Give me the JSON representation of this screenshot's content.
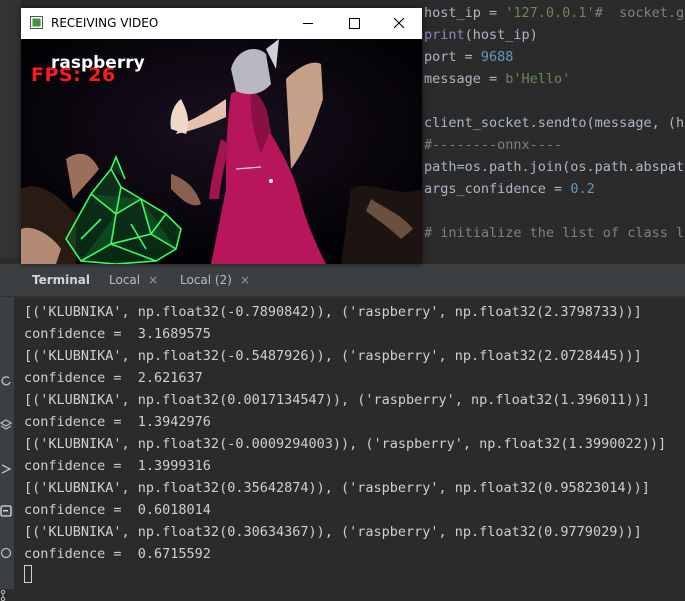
{
  "editor": {
    "lines": [
      {
        "name": "code-host-ip",
        "parts": [
          {
            "t": "host_ip = ",
            "c": "c-name"
          },
          {
            "t": "'127.0.0.1'",
            "c": "c-str"
          },
          {
            "t": "#  socket.ge",
            "c": "c-com"
          }
        ]
      },
      {
        "name": "code-print",
        "parts": [
          {
            "t": "print",
            "c": "c-kw"
          },
          {
            "t": "(host_ip)",
            "c": "c-name"
          }
        ]
      },
      {
        "name": "code-port",
        "parts": [
          {
            "t": "port = ",
            "c": "c-name"
          },
          {
            "t": "9688",
            "c": "c-num"
          }
        ]
      },
      {
        "name": "code-message",
        "parts": [
          {
            "t": "message = ",
            "c": "c-name"
          },
          {
            "t": "b'Hello'",
            "c": "c-str"
          }
        ]
      },
      {
        "name": "code-blank-1",
        "parts": []
      },
      {
        "name": "code-sendto",
        "parts": [
          {
            "t": "client_socket.sendto(message, (hos",
            "c": "c-name"
          }
        ]
      },
      {
        "name": "code-onnx-comment",
        "parts": [
          {
            "t": "#--------onnx----",
            "c": "c-com"
          }
        ]
      },
      {
        "name": "code-path",
        "parts": [
          {
            "t": "path=os.path.join(os.path.abspath",
            "c": "c-name"
          }
        ]
      },
      {
        "name": "code-confidence",
        "parts": [
          {
            "t": "args_confidence = ",
            "c": "c-name"
          },
          {
            "t": "0.2",
            "c": "c-num"
          }
        ]
      },
      {
        "name": "code-blank-2",
        "parts": []
      },
      {
        "name": "code-init-comment",
        "parts": [
          {
            "t": "# initialize the list of class la",
            "c": "c-com"
          }
        ]
      }
    ]
  },
  "terminal": {
    "title": "Terminal",
    "tabs": [
      {
        "label": "Local",
        "close": "×"
      },
      {
        "label": "Local (2)",
        "close": "×"
      }
    ],
    "output": [
      "[('KLUBNIKA', np.float32(-0.7890842)), ('raspberry', np.float32(2.3798733))]",
      "confidence =  3.1689575",
      "[('KLUBNIKA', np.float32(-0.5487926)), ('raspberry', np.float32(2.0728445))]",
      "confidence =  2.621637",
      "[('KLUBNIKA', np.float32(0.0017134547)), ('raspberry', np.float32(1.396011))]",
      "confidence =  1.3942976",
      "[('KLUBNIKA', np.float32(-0.0009294003)), ('raspberry', np.float32(1.3990022))]",
      "confidence =  1.3999316",
      "[('KLUBNIKA', np.float32(0.35642874)), ('raspberry', np.float32(0.95823014))]",
      "confidence =  0.6018014",
      "[('KLUBNIKA', np.float32(0.30634367)), ('raspberry', np.float32(0.9779029))]",
      "confidence =  0.6715592"
    ]
  },
  "video_window": {
    "title": "RECEIVING VIDEO",
    "fps_text": "FPS: 26",
    "class_label": "raspberry",
    "minimize_icon": "minimize-icon",
    "maximize_icon": "maximize-icon",
    "close_icon": "close-icon"
  },
  "colors": {
    "fps": "#ff1a1a",
    "dress": "#c2185b",
    "wireframe": "#33ff66"
  }
}
